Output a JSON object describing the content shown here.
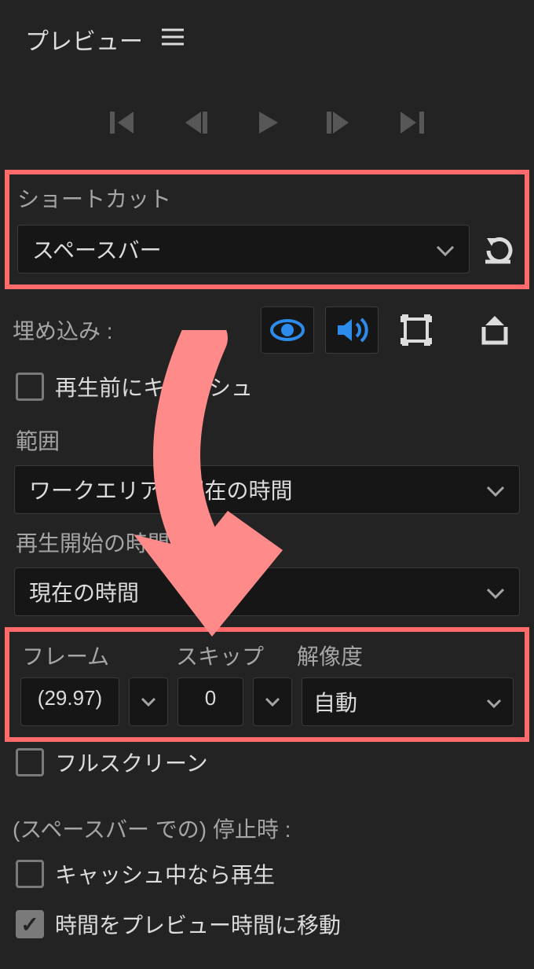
{
  "panel": {
    "title": "プレビュー"
  },
  "shortcut": {
    "label": "ショートカット",
    "value": "スペースバー"
  },
  "embed": {
    "label": "埋め込み :"
  },
  "cachebefore": {
    "label": "再生前にキャッシュ"
  },
  "range": {
    "label": "範囲",
    "value": "ワークエリアと現在の時間"
  },
  "playfrom": {
    "label": "再生開始の時間",
    "value": "現在の時間"
  },
  "cols": {
    "frame_label": "フレーム",
    "skip_label": "スキップ",
    "res_label": "解像度",
    "frame_value": "(29.97)",
    "skip_value": "0",
    "res_value": "自動"
  },
  "fullscreen": {
    "label": "フルスクリーン"
  },
  "stop": {
    "label": "(スペースバー での) 停止時 :",
    "playcache_label": "キャッシュ中なら再生",
    "movetime_label": "時間をプレビュー時間に移動"
  }
}
